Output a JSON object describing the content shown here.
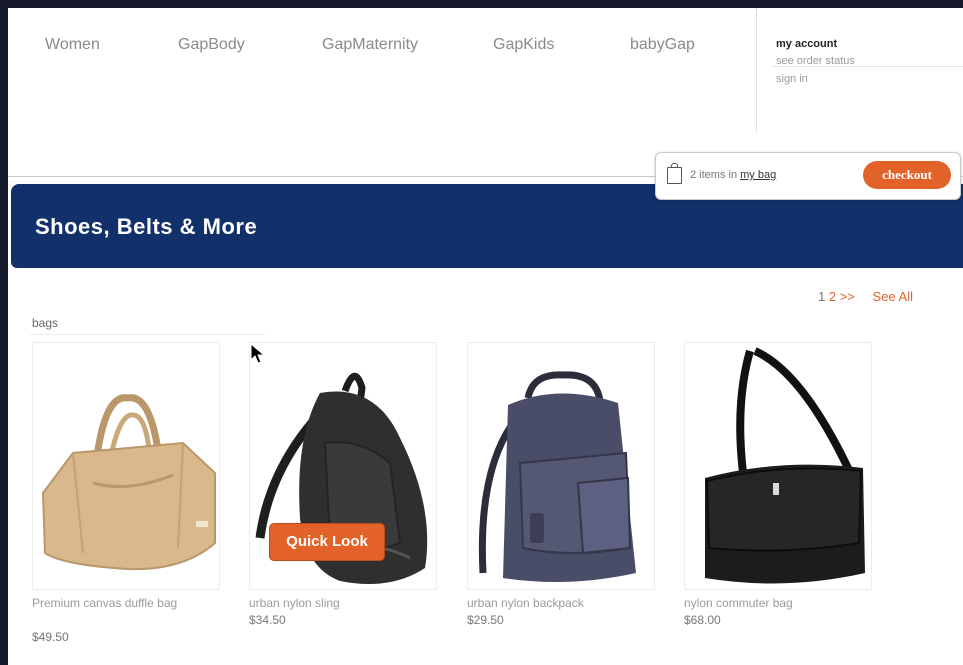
{
  "nav": {
    "links": [
      "Women",
      "GapBody",
      "GapMaternity",
      "GapKids",
      "babyGap"
    ]
  },
  "account": {
    "title": "my account",
    "order_status": "see order status",
    "sign_in": "sign in"
  },
  "bag": {
    "count_text": "2 items in",
    "link_text": "my bag",
    "checkout_label": "checkout"
  },
  "banner": {
    "title": "Shoes, Belts & More",
    "color": "#12306a"
  },
  "pagination": {
    "current": "1",
    "next_page": "2",
    "next": ">>",
    "see_all": "See All"
  },
  "section": {
    "label": "bags"
  },
  "products": [
    {
      "name": "Premium canvas duffle bag",
      "price": "$49.50",
      "icon": "duffle-bag"
    },
    {
      "name": "urban nylon sling",
      "price": "$34.50",
      "icon": "sling-backpack"
    },
    {
      "name": "urban nylon backpack",
      "price": "$29.50",
      "icon": "backpack"
    },
    {
      "name": "nylon commuter bag",
      "price": "$68.00",
      "icon": "messenger-bag"
    }
  ],
  "quicklook": {
    "label": "Quick Look"
  },
  "colors": {
    "accent": "#e3622a",
    "frame": "#15182a"
  }
}
